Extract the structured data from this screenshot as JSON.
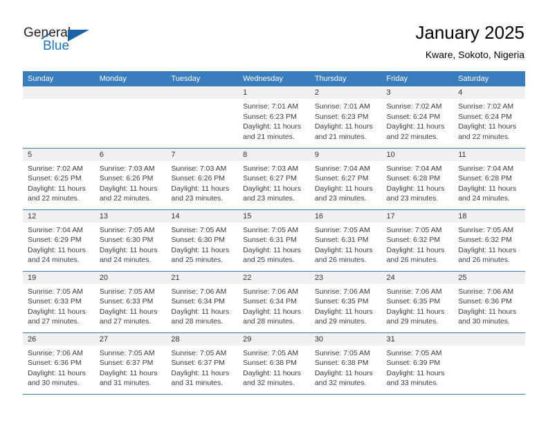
{
  "brand": {
    "name_part1": "General",
    "name_part2": "Blue"
  },
  "header": {
    "title": "January 2025",
    "subtitle": "Kware, Sokoto, Nigeria"
  },
  "calendar": {
    "weekday_headers": [
      "Sunday",
      "Monday",
      "Tuesday",
      "Wednesday",
      "Thursday",
      "Friday",
      "Saturday"
    ],
    "colors": {
      "header_bg": "#3a7dbf",
      "header_text": "#ffffff",
      "daynum_bg": "#f0f0f0",
      "cell_bg": "#ffffff",
      "row_border": "#3a7dbf",
      "brand_blue": "#1e73be"
    },
    "weeks": [
      [
        {
          "day": "",
          "empty": true
        },
        {
          "day": "",
          "empty": true
        },
        {
          "day": "",
          "empty": true
        },
        {
          "day": "1",
          "sunrise": "Sunrise: 7:01 AM",
          "sunset": "Sunset: 6:23 PM",
          "daylight": "Daylight: 11 hours and 21 minutes."
        },
        {
          "day": "2",
          "sunrise": "Sunrise: 7:01 AM",
          "sunset": "Sunset: 6:23 PM",
          "daylight": "Daylight: 11 hours and 21 minutes."
        },
        {
          "day": "3",
          "sunrise": "Sunrise: 7:02 AM",
          "sunset": "Sunset: 6:24 PM",
          "daylight": "Daylight: 11 hours and 22 minutes."
        },
        {
          "day": "4",
          "sunrise": "Sunrise: 7:02 AM",
          "sunset": "Sunset: 6:24 PM",
          "daylight": "Daylight: 11 hours and 22 minutes."
        }
      ],
      [
        {
          "day": "5",
          "sunrise": "Sunrise: 7:02 AM",
          "sunset": "Sunset: 6:25 PM",
          "daylight": "Daylight: 11 hours and 22 minutes."
        },
        {
          "day": "6",
          "sunrise": "Sunrise: 7:03 AM",
          "sunset": "Sunset: 6:26 PM",
          "daylight": "Daylight: 11 hours and 22 minutes."
        },
        {
          "day": "7",
          "sunrise": "Sunrise: 7:03 AM",
          "sunset": "Sunset: 6:26 PM",
          "daylight": "Daylight: 11 hours and 23 minutes."
        },
        {
          "day": "8",
          "sunrise": "Sunrise: 7:03 AM",
          "sunset": "Sunset: 6:27 PM",
          "daylight": "Daylight: 11 hours and 23 minutes."
        },
        {
          "day": "9",
          "sunrise": "Sunrise: 7:04 AM",
          "sunset": "Sunset: 6:27 PM",
          "daylight": "Daylight: 11 hours and 23 minutes."
        },
        {
          "day": "10",
          "sunrise": "Sunrise: 7:04 AM",
          "sunset": "Sunset: 6:28 PM",
          "daylight": "Daylight: 11 hours and 23 minutes."
        },
        {
          "day": "11",
          "sunrise": "Sunrise: 7:04 AM",
          "sunset": "Sunset: 6:28 PM",
          "daylight": "Daylight: 11 hours and 24 minutes."
        }
      ],
      [
        {
          "day": "12",
          "sunrise": "Sunrise: 7:04 AM",
          "sunset": "Sunset: 6:29 PM",
          "daylight": "Daylight: 11 hours and 24 minutes."
        },
        {
          "day": "13",
          "sunrise": "Sunrise: 7:05 AM",
          "sunset": "Sunset: 6:30 PM",
          "daylight": "Daylight: 11 hours and 24 minutes."
        },
        {
          "day": "14",
          "sunrise": "Sunrise: 7:05 AM",
          "sunset": "Sunset: 6:30 PM",
          "daylight": "Daylight: 11 hours and 25 minutes."
        },
        {
          "day": "15",
          "sunrise": "Sunrise: 7:05 AM",
          "sunset": "Sunset: 6:31 PM",
          "daylight": "Daylight: 11 hours and 25 minutes."
        },
        {
          "day": "16",
          "sunrise": "Sunrise: 7:05 AM",
          "sunset": "Sunset: 6:31 PM",
          "daylight": "Daylight: 11 hours and 26 minutes."
        },
        {
          "day": "17",
          "sunrise": "Sunrise: 7:05 AM",
          "sunset": "Sunset: 6:32 PM",
          "daylight": "Daylight: 11 hours and 26 minutes."
        },
        {
          "day": "18",
          "sunrise": "Sunrise: 7:05 AM",
          "sunset": "Sunset: 6:32 PM",
          "daylight": "Daylight: 11 hours and 26 minutes."
        }
      ],
      [
        {
          "day": "19",
          "sunrise": "Sunrise: 7:05 AM",
          "sunset": "Sunset: 6:33 PM",
          "daylight": "Daylight: 11 hours and 27 minutes."
        },
        {
          "day": "20",
          "sunrise": "Sunrise: 7:05 AM",
          "sunset": "Sunset: 6:33 PM",
          "daylight": "Daylight: 11 hours and 27 minutes."
        },
        {
          "day": "21",
          "sunrise": "Sunrise: 7:06 AM",
          "sunset": "Sunset: 6:34 PM",
          "daylight": "Daylight: 11 hours and 28 minutes."
        },
        {
          "day": "22",
          "sunrise": "Sunrise: 7:06 AM",
          "sunset": "Sunset: 6:34 PM",
          "daylight": "Daylight: 11 hours and 28 minutes."
        },
        {
          "day": "23",
          "sunrise": "Sunrise: 7:06 AM",
          "sunset": "Sunset: 6:35 PM",
          "daylight": "Daylight: 11 hours and 29 minutes."
        },
        {
          "day": "24",
          "sunrise": "Sunrise: 7:06 AM",
          "sunset": "Sunset: 6:35 PM",
          "daylight": "Daylight: 11 hours and 29 minutes."
        },
        {
          "day": "25",
          "sunrise": "Sunrise: 7:06 AM",
          "sunset": "Sunset: 6:36 PM",
          "daylight": "Daylight: 11 hours and 30 minutes."
        }
      ],
      [
        {
          "day": "26",
          "sunrise": "Sunrise: 7:06 AM",
          "sunset": "Sunset: 6:36 PM",
          "daylight": "Daylight: 11 hours and 30 minutes."
        },
        {
          "day": "27",
          "sunrise": "Sunrise: 7:05 AM",
          "sunset": "Sunset: 6:37 PM",
          "daylight": "Daylight: 11 hours and 31 minutes."
        },
        {
          "day": "28",
          "sunrise": "Sunrise: 7:05 AM",
          "sunset": "Sunset: 6:37 PM",
          "daylight": "Daylight: 11 hours and 31 minutes."
        },
        {
          "day": "29",
          "sunrise": "Sunrise: 7:05 AM",
          "sunset": "Sunset: 6:38 PM",
          "daylight": "Daylight: 11 hours and 32 minutes."
        },
        {
          "day": "30",
          "sunrise": "Sunrise: 7:05 AM",
          "sunset": "Sunset: 6:38 PM",
          "daylight": "Daylight: 11 hours and 32 minutes."
        },
        {
          "day": "31",
          "sunrise": "Sunrise: 7:05 AM",
          "sunset": "Sunset: 6:39 PM",
          "daylight": "Daylight: 11 hours and 33 minutes."
        },
        {
          "day": "",
          "empty": true
        }
      ]
    ]
  }
}
